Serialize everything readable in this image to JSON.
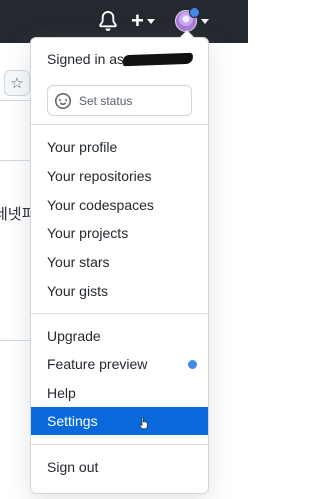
{
  "header": {
    "notification_icon": "bell-icon",
    "create_icon": "plus-icon",
    "avatar_icon": "avatar-icon"
  },
  "background": {
    "star_icon": "star-icon",
    "partial_text": "네넷피"
  },
  "menu": {
    "signed_in_label": "Signed in as",
    "set_status_label": "Set status",
    "section1": [
      "Your profile",
      "Your repositories",
      "Your codespaces",
      "Your projects",
      "Your stars",
      "Your gists"
    ],
    "section2": [
      "Upgrade",
      "Feature preview",
      "Help",
      "Settings"
    ],
    "sign_out": "Sign out",
    "active_item": "Settings"
  },
  "colors": {
    "header_bg": "#24292f",
    "accent": "#0969da",
    "notification_dot": "#4688e8"
  }
}
